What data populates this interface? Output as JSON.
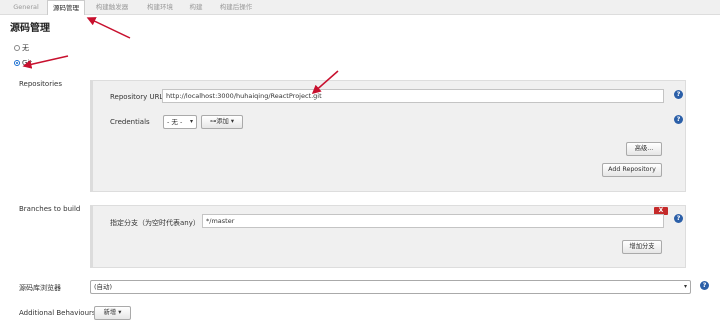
{
  "tabs": [
    {
      "label": "General",
      "active": false
    },
    {
      "label": "源码管理",
      "active": true
    },
    {
      "label": "构建触发器",
      "active": false
    },
    {
      "label": "构建环境",
      "active": false
    },
    {
      "label": "构建",
      "active": false
    },
    {
      "label": "构建后操作",
      "active": false
    }
  ],
  "section_title": "源码管理",
  "scm_options": [
    {
      "label": "无",
      "selected": false
    },
    {
      "label": "Git",
      "selected": true
    }
  ],
  "repositories": {
    "label": "Repositories",
    "url_label": "Repository URL",
    "url_value": "http://localhost:3000/huhaiqing/ReactProject.git",
    "credentials_label": "Credentials",
    "credentials_value": "- 无 -",
    "add_button": "添加",
    "advanced_button": "高级...",
    "add_repo_button": "Add Repository"
  },
  "branches": {
    "label": "Branches to build",
    "delete_button": "X",
    "specifier_label": "指定分支（为空时代表any）",
    "specifier_value": "*/master",
    "add_branch_button": "增加分支"
  },
  "browser": {
    "label": "源码库浏览器",
    "value": "(自动)"
  },
  "behaviours": {
    "label": "Additional Behaviours",
    "add_button": "新增"
  },
  "help_icon_glyph": "?",
  "colors": {
    "annotation_arrow": "#c8102e",
    "help_icon": "#2b5fa8",
    "delete_button": "#c52a2a"
  }
}
